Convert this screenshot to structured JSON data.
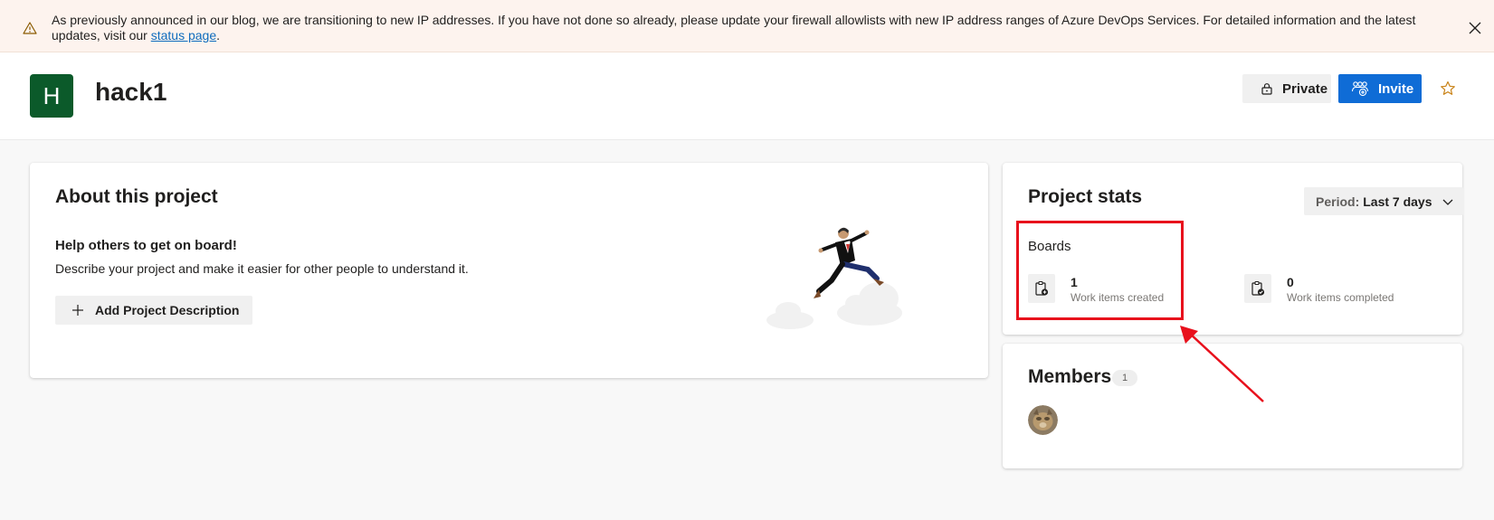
{
  "banner": {
    "message_before_link": "As previously announced in our blog, we are transitioning to new IP addresses. If you have not done so already, please update your firewall allowlists with new IP address ranges of Azure DevOps Services. For detailed information and the latest updates, visit our ",
    "link_text": "status page",
    "message_after_link": "."
  },
  "header": {
    "avatar_letter": "H",
    "project_name": "hack1",
    "private_label": "Private",
    "invite_label": "Invite"
  },
  "about": {
    "title": "About this project",
    "help_title": "Help others to get on board!",
    "help_desc": "Describe your project and make it easier for other people to understand it.",
    "add_button_label": "Add Project Description"
  },
  "stats": {
    "title": "Project stats",
    "period_key": "Period:",
    "period_value": "Last 7 days",
    "boards_label": "Boards",
    "items": [
      {
        "value": "1",
        "label": "Work items created"
      },
      {
        "value": "0",
        "label": "Work items completed"
      }
    ]
  },
  "members": {
    "title": "Members",
    "count": "1"
  },
  "colors": {
    "accent": "#0f6cd6",
    "project_avatar": "#0b5a2a",
    "highlight": "#e8101c"
  }
}
